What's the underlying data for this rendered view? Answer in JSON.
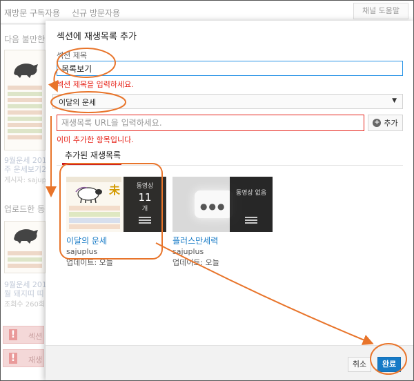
{
  "background": {
    "tabs": [
      "재방문 구독자용",
      "신규 방문자용"
    ],
    "help_button": "채널 도움말",
    "heading1": "다음 불만한",
    "video1": {
      "title_line1": "9월운세 2018",
      "title_line2": "주 운세보기2",
      "meta": "게시자: sajuplus"
    },
    "heading2": "업로드한 동",
    "video2": {
      "title_line1": "9월운세 2018",
      "title_line2": "월 돼지띠 띠",
      "meta": "조회수 260회"
    },
    "warning1": "섹션",
    "warning2": "재생"
  },
  "modal": {
    "title": "섹션에 재생목록 추가",
    "section_title_label": "섹션 제목",
    "section_title_value": "목록보기",
    "section_title_error": "섹션 제목을 입력하세요.",
    "playlist_select_value": "이달의 운세",
    "url_placeholder": "재생목록 URL을 입력하세요.",
    "add_button": "추가",
    "url_error": "이미 추가한 항목입니다.",
    "tab_label": "추가된 재생목록",
    "playlists": [
      {
        "title": "이달의 운세",
        "channel": "sajuplus",
        "updated": "업데이트: 오늘",
        "overlay_label": "동영상",
        "overlay_count": "11",
        "overlay_unit": "개",
        "thumb_title": "未"
      },
      {
        "title": "플러스만세력",
        "channel": "sajuplus",
        "updated": "업데이트: 오늘",
        "overlay_label": "동영상 없음"
      }
    ],
    "cancel_button": "취소",
    "done_button": "완료"
  },
  "colors": {
    "accent_blue": "#167ac6",
    "error_red": "#e62117",
    "annotation_orange": "#e8742a"
  }
}
